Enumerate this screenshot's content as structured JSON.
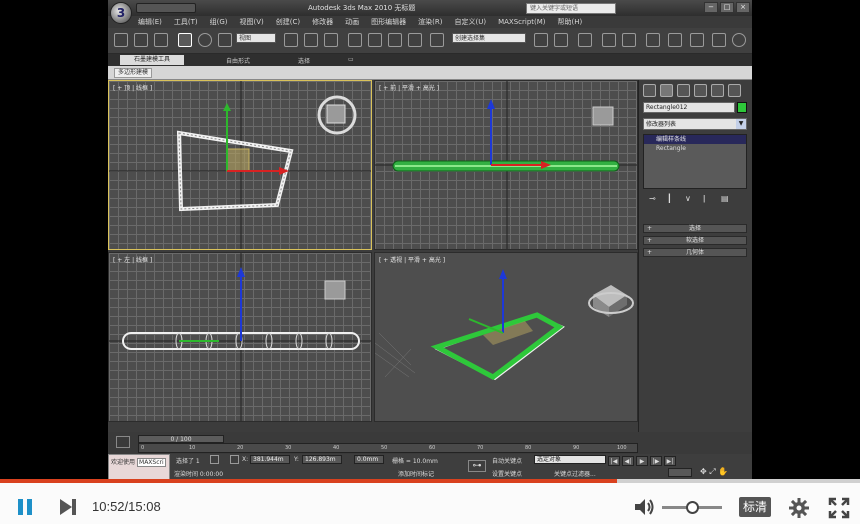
{
  "window": {
    "title": "Autodesk 3ds Max   2010     无标题",
    "search_placeholder": "键入关键字或短语",
    "controls": [
      "−",
      "□",
      "×"
    ]
  },
  "menu": [
    "编辑(E)",
    "工具(T)",
    "组(G)",
    "视图(V)",
    "创建(C)",
    "修改器",
    "动画",
    "图形编辑器",
    "渲染(R)",
    "自定义(U)",
    "MAXScript(M)",
    "帮助(H)"
  ],
  "toolbar": {
    "filter_dropdown": "全部",
    "view_dropdown": "视图",
    "selection_set": "创建选择集"
  },
  "ribbon": {
    "tabs": [
      "石墨建模工具",
      "自由形式",
      "选择",
      "▭"
    ],
    "panel_button": "多边形建模"
  },
  "viewports": {
    "top": "[ + 顶 | 线框 ]",
    "front": "[ + 前 | 平滑 + 高光 ]",
    "left": "[ + 左 | 线框 ]",
    "perspective": "[ + 透视 | 平滑 + 高光 ]"
  },
  "command_panel": {
    "object_name": "Rectangle012",
    "object_color": "#2ec83a",
    "modifier_list": "修改器列表",
    "stack": [
      "编辑样条线",
      "Rectangle"
    ],
    "rollouts": [
      "选择",
      "软选择",
      "几何体"
    ]
  },
  "timeline": {
    "slider": "0 / 100",
    "ticks": [
      "0",
      "10",
      "20",
      "30",
      "40",
      "50",
      "60",
      "70",
      "80",
      "90",
      "100"
    ]
  },
  "status": {
    "maxscript_label": "欢迎使用",
    "maxscript_box": "MAXScri",
    "selected": "选择了 1",
    "x_label": "X:",
    "x_value": "381.944m",
    "y_label": "Y:",
    "y_value": "126.893m",
    "z_value": "0.0mm",
    "grid": "栅格 = 10.0mm",
    "autokey": "自动关键点",
    "select_object": "选定对象",
    "set_key": "设置关键点",
    "key_filter": "关键点过滤器...",
    "render_time": "渲染时间 0:00:00",
    "add_time_tag": "添加时间标记"
  },
  "player": {
    "current_time": "10:52",
    "total_time": "15:08",
    "time_text": "10:52/15:08",
    "progress": 0.718,
    "volume": 0.5,
    "quality": "标清"
  }
}
